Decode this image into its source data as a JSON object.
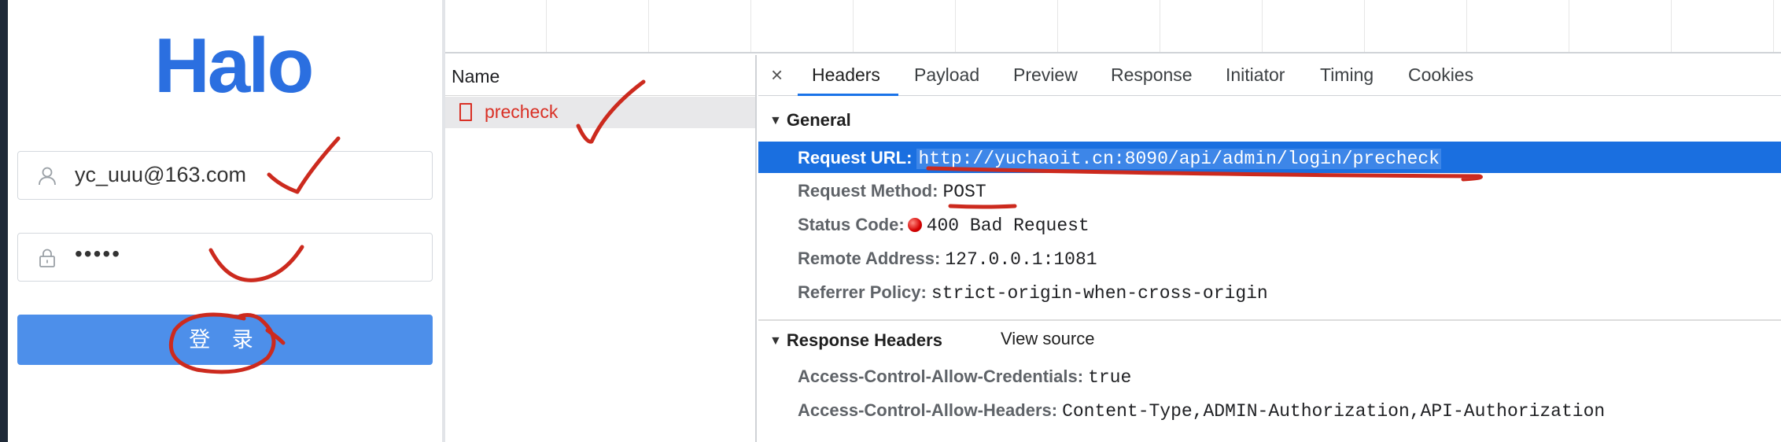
{
  "login": {
    "logo_text": "Halo",
    "username_value": "yc_uuu@163.com",
    "password_masked": "•••••",
    "submit_label": "登 录",
    "brand_color": "#2b6fe0",
    "button_color": "#4d8fea"
  },
  "network": {
    "name_column_header": "Name",
    "request_name": "precheck",
    "error_color": "#d93025"
  },
  "details": {
    "close_symbol": "×",
    "tabs": [
      "Headers",
      "Payload",
      "Preview",
      "Response",
      "Initiator",
      "Timing",
      "Cookies"
    ],
    "active_tab": "Headers",
    "general": {
      "title": "General",
      "request_url_label": "Request URL:",
      "request_url": "http://yuchaoit.cn:8090/api/admin/login/precheck",
      "request_method_label": "Request Method:",
      "request_method": "POST",
      "status_code_label": "Status Code:",
      "status_code": "400 Bad Request",
      "remote_address_label": "Remote Address:",
      "remote_address": "127.0.0.1:1081",
      "referrer_policy_label": "Referrer Policy:",
      "referrer_policy": "strict-origin-when-cross-origin"
    },
    "response_headers": {
      "title": "Response Headers",
      "view_source_label": "View source",
      "items": [
        {
          "key": "Access-Control-Allow-Credentials:",
          "value": "true"
        },
        {
          "key": "Access-Control-Allow-Headers:",
          "value": "Content-Type,ADMIN-Authorization,API-Authorization"
        }
      ]
    }
  }
}
